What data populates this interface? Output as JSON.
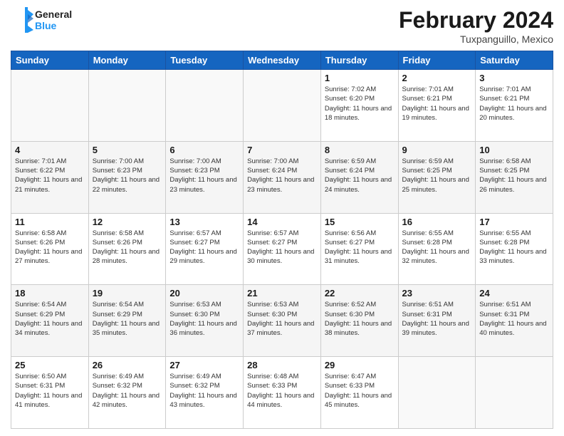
{
  "header": {
    "logo_general": "General",
    "logo_blue": "Blue",
    "month": "February 2024",
    "location": "Tuxpanguillo, Mexico"
  },
  "weekdays": [
    "Sunday",
    "Monday",
    "Tuesday",
    "Wednesday",
    "Thursday",
    "Friday",
    "Saturday"
  ],
  "weeks": [
    [
      {
        "day": "",
        "info": ""
      },
      {
        "day": "",
        "info": ""
      },
      {
        "day": "",
        "info": ""
      },
      {
        "day": "",
        "info": ""
      },
      {
        "day": "1",
        "info": "Sunrise: 7:02 AM\nSunset: 6:20 PM\nDaylight: 11 hours and 18 minutes."
      },
      {
        "day": "2",
        "info": "Sunrise: 7:01 AM\nSunset: 6:21 PM\nDaylight: 11 hours and 19 minutes."
      },
      {
        "day": "3",
        "info": "Sunrise: 7:01 AM\nSunset: 6:21 PM\nDaylight: 11 hours and 20 minutes."
      }
    ],
    [
      {
        "day": "4",
        "info": "Sunrise: 7:01 AM\nSunset: 6:22 PM\nDaylight: 11 hours and 21 minutes."
      },
      {
        "day": "5",
        "info": "Sunrise: 7:00 AM\nSunset: 6:23 PM\nDaylight: 11 hours and 22 minutes."
      },
      {
        "day": "6",
        "info": "Sunrise: 7:00 AM\nSunset: 6:23 PM\nDaylight: 11 hours and 23 minutes."
      },
      {
        "day": "7",
        "info": "Sunrise: 7:00 AM\nSunset: 6:24 PM\nDaylight: 11 hours and 23 minutes."
      },
      {
        "day": "8",
        "info": "Sunrise: 6:59 AM\nSunset: 6:24 PM\nDaylight: 11 hours and 24 minutes."
      },
      {
        "day": "9",
        "info": "Sunrise: 6:59 AM\nSunset: 6:25 PM\nDaylight: 11 hours and 25 minutes."
      },
      {
        "day": "10",
        "info": "Sunrise: 6:58 AM\nSunset: 6:25 PM\nDaylight: 11 hours and 26 minutes."
      }
    ],
    [
      {
        "day": "11",
        "info": "Sunrise: 6:58 AM\nSunset: 6:26 PM\nDaylight: 11 hours and 27 minutes."
      },
      {
        "day": "12",
        "info": "Sunrise: 6:58 AM\nSunset: 6:26 PM\nDaylight: 11 hours and 28 minutes."
      },
      {
        "day": "13",
        "info": "Sunrise: 6:57 AM\nSunset: 6:27 PM\nDaylight: 11 hours and 29 minutes."
      },
      {
        "day": "14",
        "info": "Sunrise: 6:57 AM\nSunset: 6:27 PM\nDaylight: 11 hours and 30 minutes."
      },
      {
        "day": "15",
        "info": "Sunrise: 6:56 AM\nSunset: 6:27 PM\nDaylight: 11 hours and 31 minutes."
      },
      {
        "day": "16",
        "info": "Sunrise: 6:55 AM\nSunset: 6:28 PM\nDaylight: 11 hours and 32 minutes."
      },
      {
        "day": "17",
        "info": "Sunrise: 6:55 AM\nSunset: 6:28 PM\nDaylight: 11 hours and 33 minutes."
      }
    ],
    [
      {
        "day": "18",
        "info": "Sunrise: 6:54 AM\nSunset: 6:29 PM\nDaylight: 11 hours and 34 minutes."
      },
      {
        "day": "19",
        "info": "Sunrise: 6:54 AM\nSunset: 6:29 PM\nDaylight: 11 hours and 35 minutes."
      },
      {
        "day": "20",
        "info": "Sunrise: 6:53 AM\nSunset: 6:30 PM\nDaylight: 11 hours and 36 minutes."
      },
      {
        "day": "21",
        "info": "Sunrise: 6:53 AM\nSunset: 6:30 PM\nDaylight: 11 hours and 37 minutes."
      },
      {
        "day": "22",
        "info": "Sunrise: 6:52 AM\nSunset: 6:30 PM\nDaylight: 11 hours and 38 minutes."
      },
      {
        "day": "23",
        "info": "Sunrise: 6:51 AM\nSunset: 6:31 PM\nDaylight: 11 hours and 39 minutes."
      },
      {
        "day": "24",
        "info": "Sunrise: 6:51 AM\nSunset: 6:31 PM\nDaylight: 11 hours and 40 minutes."
      }
    ],
    [
      {
        "day": "25",
        "info": "Sunrise: 6:50 AM\nSunset: 6:31 PM\nDaylight: 11 hours and 41 minutes."
      },
      {
        "day": "26",
        "info": "Sunrise: 6:49 AM\nSunset: 6:32 PM\nDaylight: 11 hours and 42 minutes."
      },
      {
        "day": "27",
        "info": "Sunrise: 6:49 AM\nSunset: 6:32 PM\nDaylight: 11 hours and 43 minutes."
      },
      {
        "day": "28",
        "info": "Sunrise: 6:48 AM\nSunset: 6:33 PM\nDaylight: 11 hours and 44 minutes."
      },
      {
        "day": "29",
        "info": "Sunrise: 6:47 AM\nSunset: 6:33 PM\nDaylight: 11 hours and 45 minutes."
      },
      {
        "day": "",
        "info": ""
      },
      {
        "day": "",
        "info": ""
      }
    ]
  ]
}
